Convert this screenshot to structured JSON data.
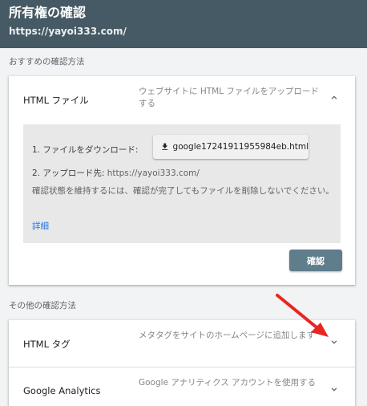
{
  "header": {
    "title": "所有権の確認",
    "url": "https://yayoi333.com/"
  },
  "recommended": {
    "section_label": "おすすめの確認方法",
    "method": {
      "name": "HTML ファイル",
      "description": "ウェブサイトに HTML ファイルをアップロードする",
      "chevron_icon": "chevron-up-icon"
    },
    "steps": {
      "step1_label": "1. ファイルをダウンロード:",
      "download_icon": "download-icon",
      "download_filename": "google17241911955984eb.html",
      "step2_label": "2. アップロード先:",
      "step2_url": "https://yayoi333.com/"
    },
    "note": "確認状態を維持するには、確認が完了してもファイルを削除しないでください。",
    "details_link": "詳細",
    "confirm_label": "確認"
  },
  "other": {
    "section_label": "その他の確認方法",
    "methods": [
      {
        "name": "HTML タグ",
        "description": "メタタグをサイトのホームページに追加します",
        "chevron_icon": "chevron-down-icon"
      },
      {
        "name": "Google Analytics",
        "description": "Google アナリティクス アカウントを使用する",
        "chevron_icon": "chevron-down-icon"
      }
    ]
  },
  "colors": {
    "header_bg": "#455a64",
    "confirm_bg": "#607d8b",
    "link": "#1a73e8",
    "annotation_arrow": "#e8261f"
  }
}
